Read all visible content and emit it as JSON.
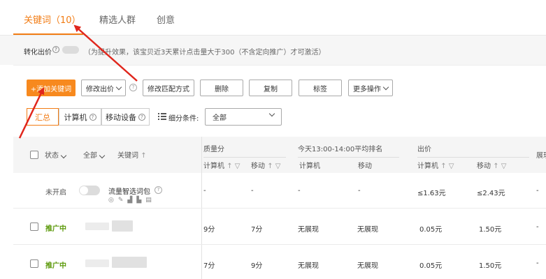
{
  "tabs": [
    {
      "label": "关键词（10）",
      "active": true
    },
    {
      "label": "精选人群",
      "active": false
    },
    {
      "label": "创意",
      "active": false
    }
  ],
  "conversion_bid": {
    "label": "转化出价",
    "help_icon": "?",
    "note": "（为提升效果，该宝贝近3天累计点击量大于300（不含定向推广）才可激活）"
  },
  "toolbar": {
    "add_keyword": "+添加关键词",
    "modify_bid": "修改出价",
    "modify_match": "修改匹配方式",
    "delete": "删除",
    "copy": "复制",
    "tag": "标签",
    "more_ops": "更多操作"
  },
  "segments": [
    {
      "label": "汇总",
      "selected": true
    },
    {
      "label": "计算机",
      "help": "?"
    },
    {
      "label": "移动设备",
      "help": "?"
    }
  ],
  "filter": {
    "label": "细分条件:",
    "value": "全部"
  },
  "table": {
    "headers": {
      "status": "状态",
      "all": "全部",
      "keyword": "关键词",
      "quality": "质量分",
      "rank": "今天13:00-14:00平均排名",
      "bid": "出价",
      "more": "展现",
      "computer": "计算机",
      "mobile": "移动"
    },
    "rows": [
      {
        "status": "未开启",
        "keyword": "流量智选词包",
        "quality_pc": "-",
        "quality_mobile": "-",
        "rank_pc": "-",
        "rank_mobile": "-",
        "bid_pc": "≤1.63元",
        "bid_mobile": "≤2.43元",
        "more": "-"
      },
      {
        "status": "推广中",
        "keyword": "",
        "quality_pc": "9分",
        "quality_mobile": "7分",
        "rank_pc": "无展现",
        "rank_mobile": "无展现",
        "bid_pc": "0.05元",
        "bid_mobile": "1.50元",
        "more": "-"
      },
      {
        "status": "推广中",
        "keyword": "",
        "quality_pc": "7分",
        "quality_mobile": "9分",
        "rank_pc": "无展现",
        "rank_mobile": "无展现",
        "bid_pc": "0.05元",
        "bid_mobile": "1.50元",
        "more": "-"
      }
    ]
  },
  "colors": {
    "accent": "#f27c14",
    "promoting": "#5d9a0c",
    "annotation_arrow": "#e0261c"
  }
}
